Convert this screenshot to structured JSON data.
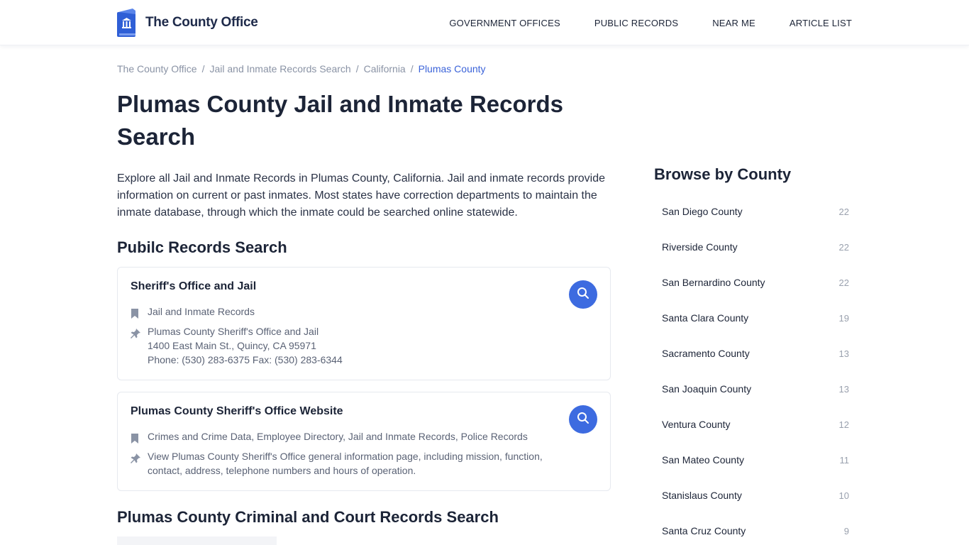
{
  "brand": {
    "name": "The County Office"
  },
  "nav": [
    "GOVERNMENT OFFICES",
    "PUBLIC RECORDS",
    "NEAR ME",
    "ARTICLE LIST"
  ],
  "breadcrumb": [
    "The County Office",
    "Jail and Inmate Records Search",
    "California",
    "Plumas County"
  ],
  "page": {
    "title": "Plumas County Jail and Inmate Records Search",
    "intro": "Explore all Jail and Inmate Records in Plumas County, California. Jail and inmate records provide information on current or past inmates. Most states have correction departments to maintain the inmate database, through which the inmate could be searched online statewide."
  },
  "section1": {
    "heading": "Pubilc Records Search",
    "cards": [
      {
        "title": "Sheriff's Office and Jail",
        "tags": "Jail and Inmate Records",
        "address_lines": [
          "Plumas County Sheriff's Office and Jail",
          "1400 East Main St., Quincy, CA 95971",
          "Phone: (530) 283-6375 Fax: (530) 283-6344"
        ]
      },
      {
        "title": "Plumas County Sheriff's Office Website",
        "tags": "Crimes and Crime Data, Employee Directory, Jail and Inmate Records, Police Records",
        "address_lines": [
          "View Plumas County Sheriff's Office general information page, including mission, function, contact, address, telephone numbers and hours of operation."
        ]
      }
    ]
  },
  "section2": {
    "heading": "Plumas County Criminal and Court Records Search"
  },
  "sidebar": {
    "title": "Browse by County",
    "counties": [
      {
        "name": "San Diego County",
        "count": "22"
      },
      {
        "name": "Riverside County",
        "count": "22"
      },
      {
        "name": "San Bernardino County",
        "count": "22"
      },
      {
        "name": "Santa Clara County",
        "count": "19"
      },
      {
        "name": "Sacramento County",
        "count": "13"
      },
      {
        "name": "San Joaquin County",
        "count": "13"
      },
      {
        "name": "Ventura County",
        "count": "12"
      },
      {
        "name": "San Mateo County",
        "count": "11"
      },
      {
        "name": "Stanislaus County",
        "count": "10"
      },
      {
        "name": "Santa Cruz County",
        "count": "9"
      }
    ]
  },
  "colors": {
    "accent": "#3d6be0",
    "text": "#1c2437",
    "muted": "#8a93a5"
  },
  "icons": {
    "logo": "book-building-icon",
    "search": "search-icon",
    "tag": "bookmark-icon",
    "address": "pin-icon"
  }
}
